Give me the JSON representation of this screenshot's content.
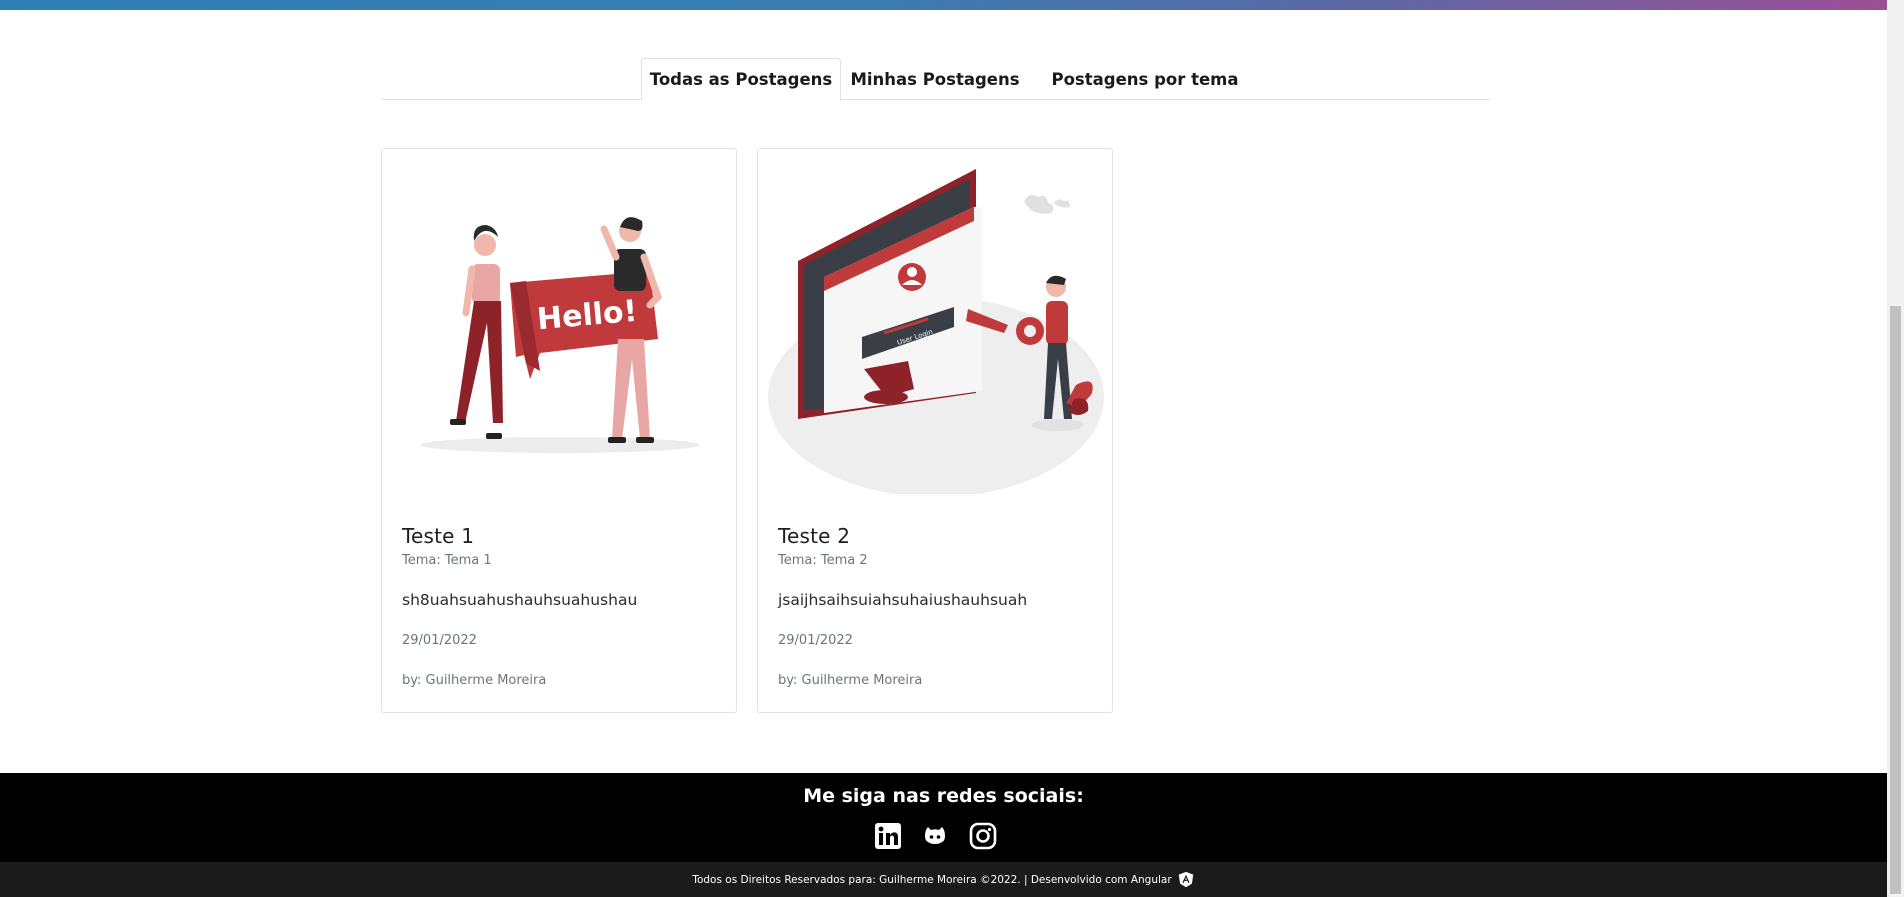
{
  "tabs": [
    {
      "label": "Todas as Postagens",
      "active": true
    },
    {
      "label": "Minhas Postagens",
      "active": false
    },
    {
      "label": "Postagens por tema",
      "active": false
    }
  ],
  "posts": [
    {
      "title": "Teste 1",
      "theme": "Tema: Tema 1",
      "text": "sh8uahsuahushauhsuahushau",
      "date": "29/01/2022",
      "author": "by: Guilherme Moreira",
      "image_text": "Hello!"
    },
    {
      "title": "Teste 2",
      "theme": "Tema: Tema 2",
      "text": "jsaijhsaihsuiahsuhaiushauhsuah",
      "date": "29/01/2022",
      "author": "by: Guilherme Moreira",
      "image_text": "User Login"
    }
  ],
  "footer": {
    "heading": "Me siga nas redes sociais:",
    "social_icons": [
      "linkedin-icon",
      "github-icon",
      "instagram-icon"
    ],
    "copyright": "Todos os Direitos Reservados para: Guilherme Moreira ©2022. | Desenvolvido com Angular"
  },
  "colors": {
    "accent_red": "#c0393b",
    "dark_red": "#8e2229",
    "footer_bg": "#000000",
    "footer_bottom_bg": "#1b1b1b"
  }
}
